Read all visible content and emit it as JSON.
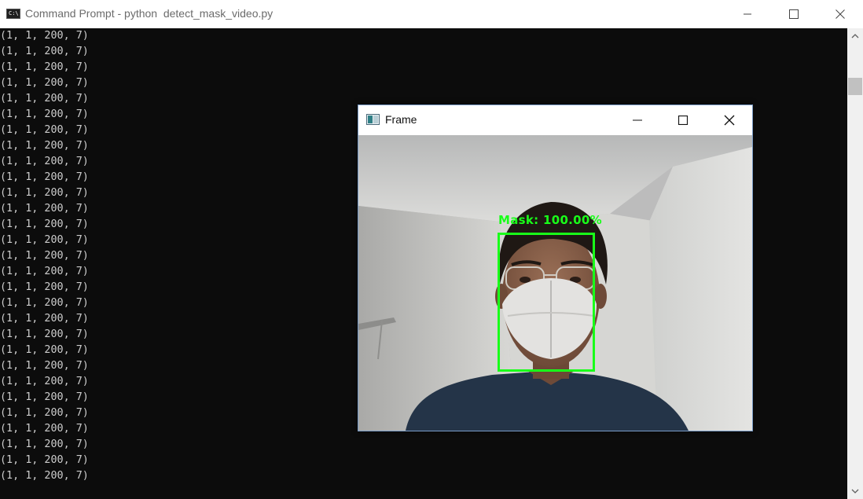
{
  "console_window": {
    "title": "Command Prompt - python  detect_mask_video.py",
    "icon": "cmd-icon",
    "icon_text": "C:\\",
    "lines": [
      "(1, 1, 200, 7)",
      "(1, 1, 200, 7)",
      "(1, 1, 200, 7)",
      "(1, 1, 200, 7)",
      "(1, 1, 200, 7)",
      "(1, 1, 200, 7)",
      "(1, 1, 200, 7)",
      "(1, 1, 200, 7)",
      "(1, 1, 200, 7)",
      "(1, 1, 200, 7)",
      "(1, 1, 200, 7)",
      "(1, 1, 200, 7)",
      "(1, 1, 200, 7)",
      "(1, 1, 200, 7)",
      "(1, 1, 200, 7)",
      "(1, 1, 200, 7)",
      "(1, 1, 200, 7)",
      "(1, 1, 200, 7)",
      "(1, 1, 200, 7)",
      "(1, 1, 200, 7)",
      "(1, 1, 200, 7)",
      "(1, 1, 200, 7)",
      "(1, 1, 200, 7)",
      "(1, 1, 200, 7)",
      "(1, 1, 200, 7)",
      "(1, 1, 200, 7)",
      "(1, 1, 200, 7)",
      "(1, 1, 200, 7)",
      "(1, 1, 200, 7)"
    ],
    "colors": {
      "background": "#0c0c0c",
      "text": "#cccccc"
    }
  },
  "frame_window": {
    "title": "Frame",
    "detection_label": "Mask: 100.00%",
    "box_color": "#19ff19"
  }
}
